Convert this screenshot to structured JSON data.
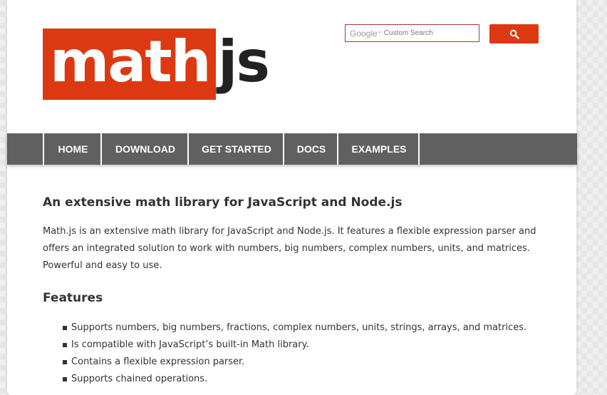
{
  "logo": {
    "math": "math",
    "js": "js",
    "colors": {
      "box": "#dc3912",
      "js": "#222222"
    }
  },
  "search": {
    "brand": "Google",
    "brand_mark": "™",
    "placeholder": "Custom Search",
    "button_icon": "search-icon",
    "button_color": "#dc3912"
  },
  "nav": {
    "items": [
      "HOME",
      "DOWNLOAD",
      "GET STARTED",
      "DOCS",
      "EXAMPLES"
    ],
    "background": "#606060"
  },
  "main": {
    "heading": "An extensive math library for JavaScript and Node.js",
    "intro": "Math.js is an extensive math library for JavaScript and Node.js. It features a flexible expression parser and offers an integrated solution to work with numbers, big numbers, complex numbers, units, and matrices. Powerful and easy to use.",
    "features_heading": "Features",
    "features": [
      "Supports numbers, big numbers, fractions, complex numbers, units, strings, arrays, and matrices.",
      "Is compatible with JavaScript’s built-in Math library.",
      "Contains a flexible expression parser.",
      "Supports chained operations."
    ]
  }
}
